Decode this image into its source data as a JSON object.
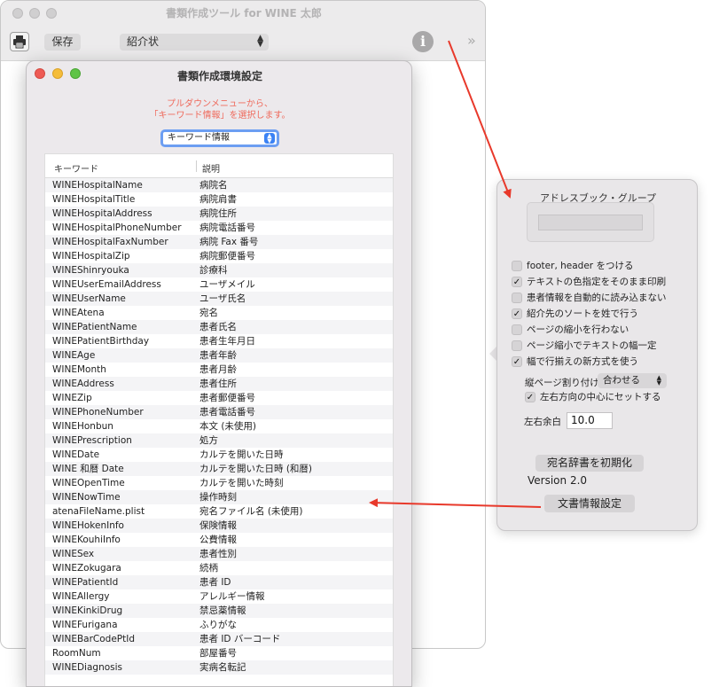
{
  "main_window": {
    "title": "書類作成ツール for WINE 太郎",
    "save_label": "保存",
    "doc_type_selected": "紹介状",
    "info_glyph": "i",
    "more_glyph": "»",
    "icons": {
      "print": "printer-icon",
      "info": "info-icon",
      "more": "chevron-double-right-icon"
    }
  },
  "settings_window": {
    "title": "書類作成環境設定",
    "instruction_line1": "プルダウンメニューから、",
    "instruction_line2": "「キーワード情報」を選択します。",
    "select_value": "キーワード情報",
    "columns": {
      "keyword": "キーワード",
      "description": "説明"
    },
    "rows": [
      {
        "keyword": "WINEHospitalName",
        "description": "病院名"
      },
      {
        "keyword": "WINEHospitalTitle",
        "description": "病院肩書"
      },
      {
        "keyword": "WINEHospitalAddress",
        "description": "病院住所"
      },
      {
        "keyword": "WINEHospitalPhoneNumber",
        "description": "病院電話番号"
      },
      {
        "keyword": "WINEHospitalFaxNumber",
        "description": "病院 Fax 番号"
      },
      {
        "keyword": "WINEHospitalZip",
        "description": "病院郵便番号"
      },
      {
        "keyword": "WINEShinryouka",
        "description": "診療科"
      },
      {
        "keyword": "WINEUserEmailAddress",
        "description": "ユーザメイル"
      },
      {
        "keyword": "WINEUserName",
        "description": "ユーザ氏名"
      },
      {
        "keyword": "WINEAtena",
        "description": "宛名"
      },
      {
        "keyword": "WINEPatientName",
        "description": "患者氏名"
      },
      {
        "keyword": "WINEPatientBirthday",
        "description": "患者生年月日"
      },
      {
        "keyword": "WINEAge",
        "description": "患者年齢"
      },
      {
        "keyword": "WINEMonth",
        "description": "患者月齢"
      },
      {
        "keyword": "WINEAddress",
        "description": "患者住所"
      },
      {
        "keyword": "WINEZip",
        "description": "患者郵便番号"
      },
      {
        "keyword": "WINEPhoneNumber",
        "description": "患者電話番号"
      },
      {
        "keyword": "WINEHonbun",
        "description": "本文 (未使用)"
      },
      {
        "keyword": "WINEPrescription",
        "description": "処方"
      },
      {
        "keyword": "WINEDate",
        "description": "カルテを開いた日時"
      },
      {
        "keyword": "WINE 和暦 Date",
        "description": "カルテを開いた日時 (和暦)"
      },
      {
        "keyword": "WINEOpenTime",
        "description": "カルテを開いた時刻"
      },
      {
        "keyword": "WINENowTime",
        "description": "操作時刻"
      },
      {
        "keyword": "atenaFileName.plist",
        "description": "宛名ファイル名 (未使用)"
      },
      {
        "keyword": "WINEHokenInfo",
        "description": "保険情報"
      },
      {
        "keyword": "WINEKouhiInfo",
        "description": "公費情報"
      },
      {
        "keyword": "WINESex",
        "description": "患者性別"
      },
      {
        "keyword": "WINEZokugara",
        "description": "続柄"
      },
      {
        "keyword": "WINEPatientId",
        "description": "患者 ID"
      },
      {
        "keyword": "WINEAllergy",
        "description": "アレルギー情報"
      },
      {
        "keyword": "WINEKinkiDrug",
        "description": "禁忌薬情報"
      },
      {
        "keyword": "WINEFurigana",
        "description": "ふりがな"
      },
      {
        "keyword": "WINEBarCodePtId",
        "description": "患者 ID バーコード"
      },
      {
        "keyword": "RoomNum",
        "description": "部屋番号"
      },
      {
        "keyword": "WINEDiagnosis",
        "description": "実病名転記"
      }
    ]
  },
  "popover": {
    "address_title": "アドレスブック・グループ",
    "check_glyph": "✓",
    "checkboxes": [
      {
        "label": "footer, header をつける",
        "checked": false
      },
      {
        "label": "テキストの色指定をそのまま印刷",
        "checked": true
      },
      {
        "label": "患者情報を自動的に読み込まない",
        "checked": false
      },
      {
        "label": "紹介先のソートを姓で行う",
        "checked": true
      },
      {
        "label": "ページの縮小を行わない",
        "checked": false
      },
      {
        "label": "ページ縮小でテキストの幅一定",
        "checked": false
      },
      {
        "label": "幅で行揃えの新方式を使う",
        "checked": true
      }
    ],
    "paging_label": "縦ページ割り付け",
    "paging_value": "合わせる",
    "center_label": "左右方向の中心にセットする",
    "center_checked": true,
    "margin_label": "左右余白",
    "margin_value": "10.0",
    "init_dict_label": "宛名辞書を初期化",
    "version": "Version 2.0",
    "doc_info_label": "文書情報設定"
  },
  "colors": {
    "instruction": "#ef6a5c",
    "arrow": "#e8392b",
    "focus_ring": "#6c9ef2",
    "close": "#ee5b55",
    "minimize": "#f5bd3a",
    "zoom": "#5fc446"
  }
}
